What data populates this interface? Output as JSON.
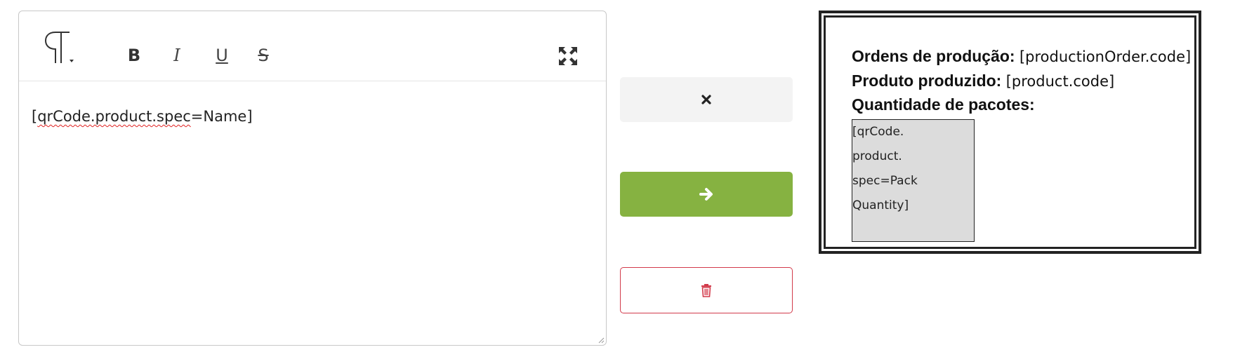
{
  "editor": {
    "toolbar": {
      "paragraph_icon": "pilcrow-icon",
      "bold_label": "B",
      "italic_label": "I",
      "underline_label": "U",
      "strike_label": "S",
      "fullscreen_icon": "expand-icon"
    },
    "content": {
      "part_misspelled": "qrCode.product.spec",
      "open_bracket": "[",
      "rest": "=Name]"
    }
  },
  "actions": {
    "cancel_icon": "close-icon",
    "apply_icon": "arrow-right-icon",
    "delete_icon": "trash-icon",
    "apply_color": "#86b241",
    "cancel_color": "#f3f3f3",
    "delete_color": "#d23a4a"
  },
  "preview": {
    "lines": [
      {
        "label": "Ordens de produção:",
        "value": "[productionOrder.code]"
      },
      {
        "label": "Produto produzido:",
        "value": "[product.code]"
      },
      {
        "label": "Quantidade de pacotes:",
        "value": ""
      }
    ],
    "box_lines": [
      "[qrCode.",
      "product.",
      "spec=Pack",
      "Quantity]"
    ]
  }
}
